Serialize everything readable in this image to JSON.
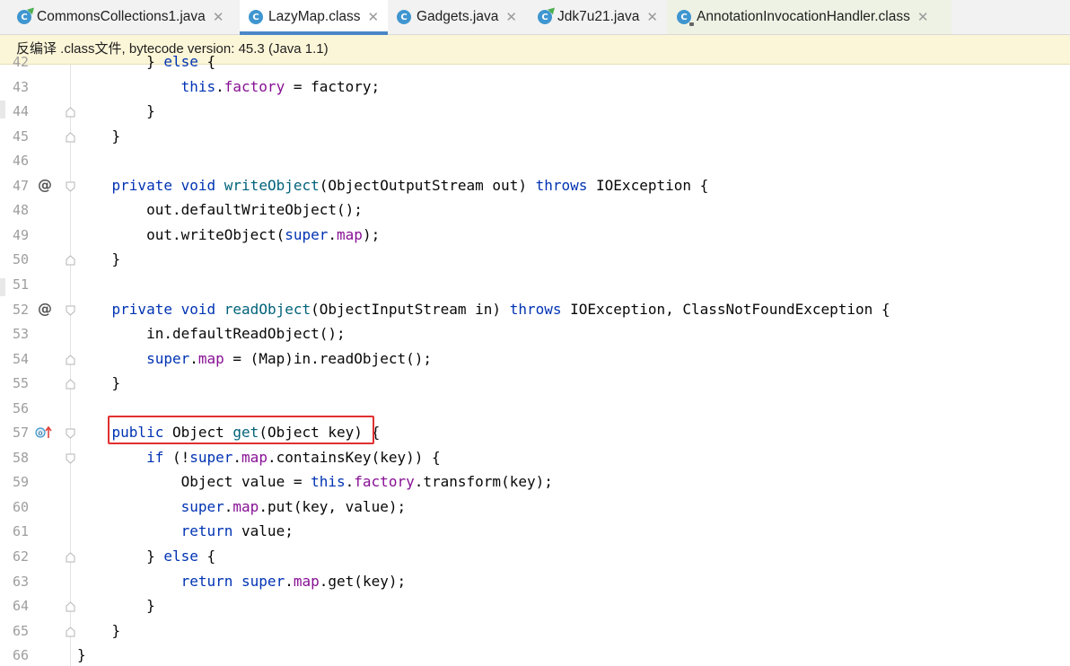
{
  "tabs": [
    {
      "label": "CommonsCollections1.java",
      "icon": "class-run-icon",
      "active": false
    },
    {
      "label": "LazyMap.class",
      "icon": "class-icon",
      "active": true
    },
    {
      "label": "Gadgets.java",
      "icon": "class-icon",
      "active": false
    },
    {
      "label": "Jdk7u21.java",
      "icon": "class-run-icon",
      "active": false
    },
    {
      "label": "AnnotationInvocationHandler.class",
      "icon": "class-locked-icon",
      "active": false
    }
  ],
  "tab_close_glyph": "✕",
  "banner": {
    "text": "反编译 .class文件, bytecode version: 45.3 (Java 1.1)"
  },
  "editor": {
    "line_numbers": [
      "42",
      "43",
      "44",
      "45",
      "46",
      "47",
      "48",
      "49",
      "50",
      "51",
      "52",
      "53",
      "54",
      "55",
      "56",
      "57",
      "58",
      "59",
      "60",
      "61",
      "62",
      "63",
      "64",
      "65",
      "66"
    ],
    "gutter_markers": {
      "47": "@",
      "52": "@",
      "57": "override-icon"
    },
    "code_lines": [
      "        } else {",
      "            this.factory = factory;",
      "        }",
      "    }",
      "",
      "    private void writeObject(ObjectOutputStream out) throws IOException {",
      "        out.defaultWriteObject();",
      "        out.writeObject(super.map);",
      "    }",
      "",
      "    private void readObject(ObjectInputStream in) throws IOException, ClassNotFoundException {",
      "        in.defaultReadObject();",
      "        super.map = (Map)in.readObject();",
      "    }",
      "",
      "    public Object get(Object key) {",
      "        if (!super.map.containsKey(key)) {",
      "            Object value = this.factory.transform(key);",
      "            super.map.put(key, value);",
      "            return value;",
      "        } else {",
      "            return super.map.get(key);",
      "        }",
      "    }",
      "}"
    ],
    "highlighted_line": "57",
    "colors": {
      "keyword": "#0033b3",
      "field": "#871094",
      "method": "#00627a",
      "highlight_box": "#e03030"
    }
  }
}
